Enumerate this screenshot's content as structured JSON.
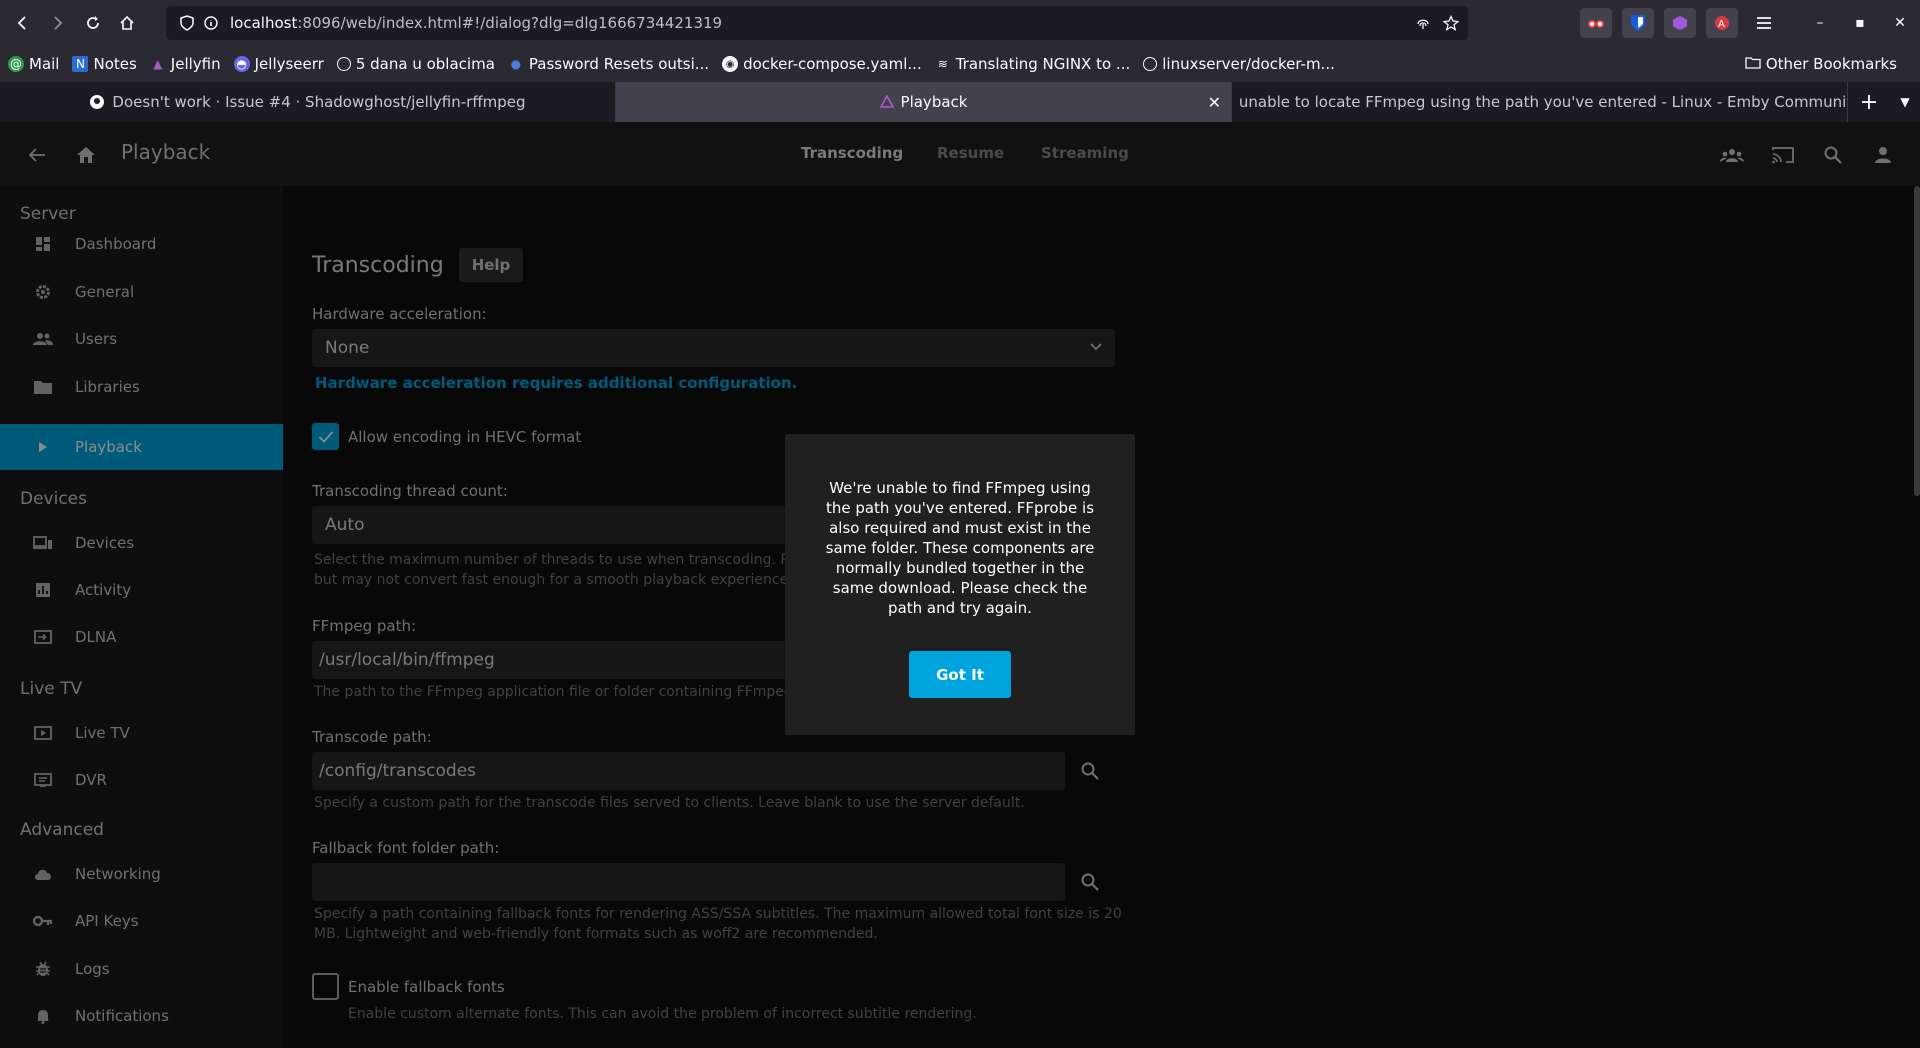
{
  "browser": {
    "url_host": "localhost",
    "url_rest": ":8096/web/index.html#!/dialog?dlg=dlg1666734421319",
    "bookmarks": [
      "Mail",
      "Notes",
      "Jellyfin",
      "Jellyseerr",
      "5 dana u oblacima",
      "Password Resets outsi...",
      "docker-compose.yaml...",
      "Translating NGINX to ...",
      "linuxserver/docker-m..."
    ],
    "other_bookmarks": "Other Bookmarks",
    "tabs": [
      {
        "title": "Doesn't work · Issue #4 · Shadowghost/jellyfin-rffmpeg",
        "icon": "github-icon"
      },
      {
        "title": "Playback",
        "icon": "jellyfin-icon"
      },
      {
        "title": "unable to locate FFmpeg using the path you've entered - Linux - Emby Community",
        "icon": "emby-icon"
      }
    ],
    "accent": "#00a4dc"
  },
  "header": {
    "title": "Playback",
    "tabs": [
      "Transcoding",
      "Resume",
      "Streaming"
    ]
  },
  "sidebar": {
    "sections": {
      "server": "Server",
      "devices": "Devices",
      "livetv": "Live TV",
      "advanced": "Advanced"
    },
    "items": {
      "dashboard": "Dashboard",
      "general": "General",
      "users": "Users",
      "libraries": "Libraries",
      "playback": "Playback",
      "devices": "Devices",
      "activity": "Activity",
      "dlna": "DLNA",
      "livetv": "Live TV",
      "dvr": "DVR",
      "networking": "Networking",
      "apikeys": "API Keys",
      "logs": "Logs",
      "notifications": "Notifications"
    }
  },
  "main": {
    "title": "Transcoding",
    "help": "Help",
    "hw_label": "Hardware acceleration:",
    "hw_value": "None",
    "hw_link": "Hardware acceleration requires additional configuration.",
    "hevc_label": "Allow encoding in HEVC format",
    "hevc_checked": true,
    "threads_label": "Transcoding thread count:",
    "threads_value": "Auto",
    "threads_desc_1": "Select the maximum number of threads to use when transcoding. R",
    "threads_desc_2": "but may not convert fast enough for a smooth playback experience",
    "ffmpeg_label": "FFmpeg path:",
    "ffmpeg_value": "/usr/local/bin/ffmpeg",
    "ffmpeg_desc": "The path to the FFmpeg application file or folder containing FFmpeg",
    "transcode_label": "Transcode path:",
    "transcode_value": "/config/transcodes",
    "transcode_desc": "Specify a custom path for the transcode files served to clients. Leave blank to use the server default.",
    "font_label": "Fallback font folder path:",
    "font_value": "",
    "font_desc_1": "Specify a path containing fallback fonts for rendering ASS/SSA subtitles. The maximum allowed total font size is 20",
    "font_desc_2": "MB. Lightweight and web-friendly font formats such as woff2 are recommended.",
    "fallback_label": "Enable fallback fonts",
    "fallback_checked": false,
    "fallback_desc": "Enable custom alternate fonts. This can avoid the problem of incorrect subtitle rendering."
  },
  "dialog": {
    "message": "We're unable to find FFmpeg using the path you've entered. FFprobe is also required and must exist in the same folder. These components are normally bundled together in the same download. Please check the path and try again.",
    "button": "Got It"
  }
}
